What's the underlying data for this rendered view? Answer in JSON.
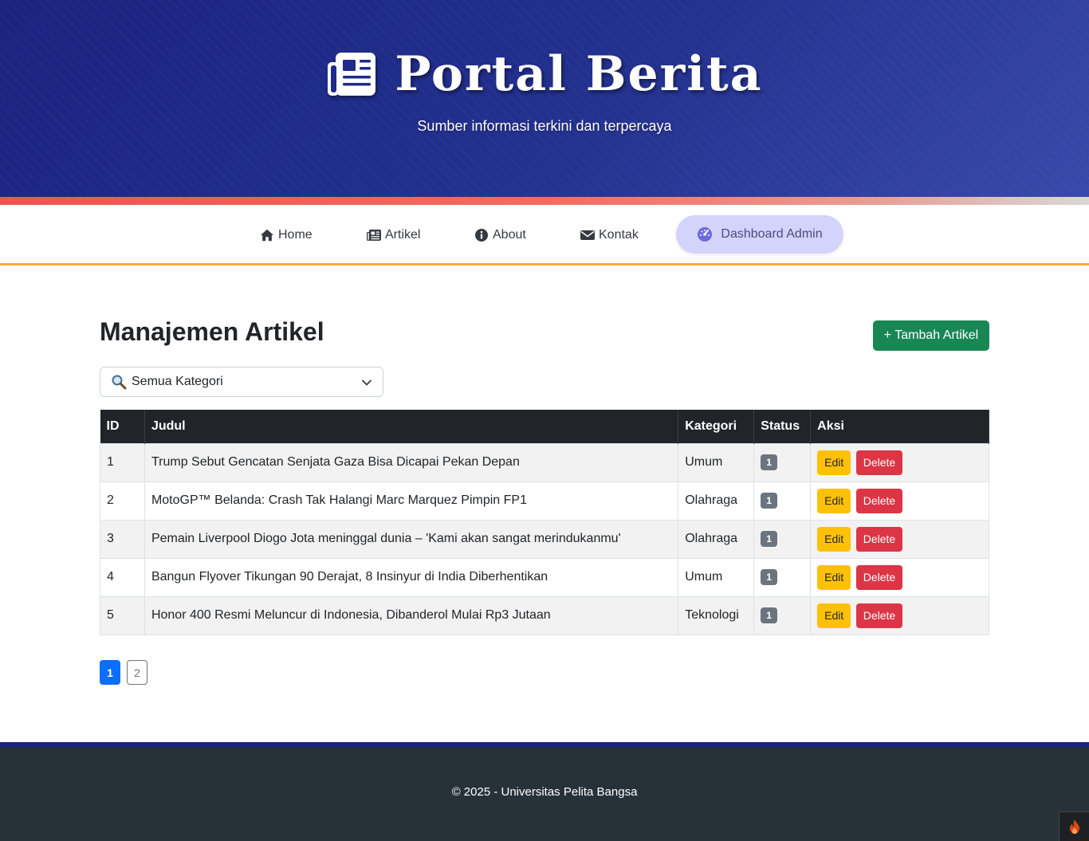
{
  "header": {
    "title": "Portal Berita",
    "tagline": "Sumber informasi terkini dan terpercaya"
  },
  "nav": {
    "items": [
      {
        "label": "Home",
        "icon": "home-icon"
      },
      {
        "label": "Artikel",
        "icon": "newspaper-icon"
      },
      {
        "label": "About",
        "icon": "info-icon"
      },
      {
        "label": "Kontak",
        "icon": "envelope-icon"
      }
    ],
    "dashboard_label": "Dashboard Admin"
  },
  "main": {
    "title": "Manajemen Artikel",
    "add_button": "+ Tambah Artikel",
    "filter_label": "Semua Kategori"
  },
  "table": {
    "headers": [
      "ID",
      "Judul",
      "Kategori",
      "Status",
      "Aksi"
    ],
    "edit_label": "Edit",
    "delete_label": "Delete",
    "rows": [
      {
        "id": "1",
        "judul": "Trump Sebut Gencatan Senjata Gaza Bisa Dicapai Pekan Depan",
        "kategori": "Umum",
        "status": "1"
      },
      {
        "id": "2",
        "judul": "MotoGP™ Belanda: Crash Tak Halangi Marc Marquez Pimpin FP1",
        "kategori": "Olahraga",
        "status": "1"
      },
      {
        "id": "3",
        "judul": "Pemain Liverpool Diogo Jota meninggal dunia – 'Kami akan sangat merindukanmu'",
        "kategori": "Olahraga",
        "status": "1"
      },
      {
        "id": "4",
        "judul": "Bangun Flyover Tikungan 90 Derajat, 8 Insinyur di India Diberhentikan",
        "kategori": "Umum",
        "status": "1"
      },
      {
        "id": "5",
        "judul": "Honor 400 Resmi Meluncur di Indonesia, Dibanderol Mulai Rp3 Jutaan",
        "kategori": "Teknologi",
        "status": "1"
      }
    ]
  },
  "pagination": {
    "pages": [
      "1",
      "2"
    ],
    "current": "1"
  },
  "footer": {
    "text": "© 2025 - Universitas Pelita Bangsa"
  },
  "colors": {
    "header": "#1a237e",
    "accent_orange": "#f9a93a",
    "add_button": "#198754",
    "edit": "#ffc107",
    "delete": "#dc3545",
    "footer": "#263238"
  }
}
